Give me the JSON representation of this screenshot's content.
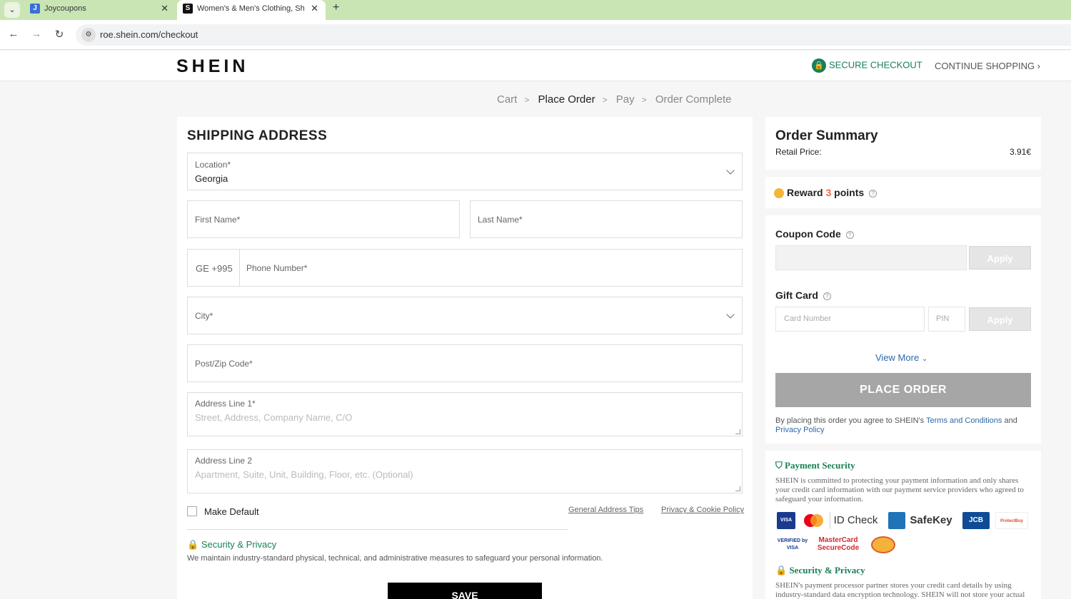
{
  "browser": {
    "tabs": [
      {
        "title": "Joycoupons",
        "favicon": "J"
      },
      {
        "title": "Women's & Men's Clothing, Sh",
        "favicon": "S"
      }
    ],
    "url": "roe.shein.com/checkout"
  },
  "header": {
    "logo": "SHEIN",
    "secure_checkout": "SECURE CHECKOUT",
    "continue_shopping": "CONTINUE SHOPPING",
    "continue_arrow": "›"
  },
  "breadcrumb": {
    "steps": [
      "Cart",
      "Place Order",
      "Pay",
      "Order Complete"
    ],
    "separator": ">"
  },
  "shipping": {
    "title": "SHIPPING ADDRESS",
    "location_label": "Location*",
    "location_value": "Georgia",
    "first_name": "First Name*",
    "last_name": "Last Name*",
    "phone_code": "GE +995",
    "phone": "Phone Number*",
    "city": "City*",
    "zip": "Post/Zip Code*",
    "address1_label": "Address Line 1*",
    "address1_placeholder": "Street, Address, Company Name, C/O",
    "address2_label": "Address Line 2",
    "address2_placeholder": "Apartment, Suite, Unit, Building, Floor, etc. (Optional)",
    "make_default": "Make Default",
    "general_tips": "General Address Tips",
    "privacy_policy": "Privacy & Cookie Policy",
    "security_title": "Security & Privacy",
    "security_text": "We maintain industry-standard physical, technical, and administrative measures to safeguard your personal information.",
    "save": "SAVE"
  },
  "summary": {
    "title": "Order Summary",
    "retail_label": "Retail Price:",
    "retail_value": "3.91€",
    "reward_prefix": "Reward",
    "reward_points": "3",
    "reward_suffix": "points",
    "coupon_title": "Coupon Code",
    "apply": "Apply",
    "giftcard_title": "Gift Card",
    "card_number": "Card Number",
    "pin": "PIN",
    "view_more": "View More",
    "place_order": "PLACE ORDER",
    "agree_text": "By placing this order you agree to SHEIN's",
    "terms": "Terms and Conditions",
    "and": "and",
    "privacy": "Privacy Policy"
  },
  "payment_security": {
    "title": "Payment Security",
    "text": "SHEIN is committed to protecting your payment information and only shares your credit card information with our payment service providers who agreed to safeguard your information.",
    "badges": [
      "VISA",
      "ID Check",
      "SafeKey",
      "JCB",
      "ProtectBuy",
      "VERIFIED by VISA",
      "MasterCard SecureCode"
    ],
    "security_title": "Security & Privacy",
    "security_text": "SHEIN's payment processor partner stores your credit card details by using industry-standard data encryption technology. SHEIN will not store your actual"
  }
}
